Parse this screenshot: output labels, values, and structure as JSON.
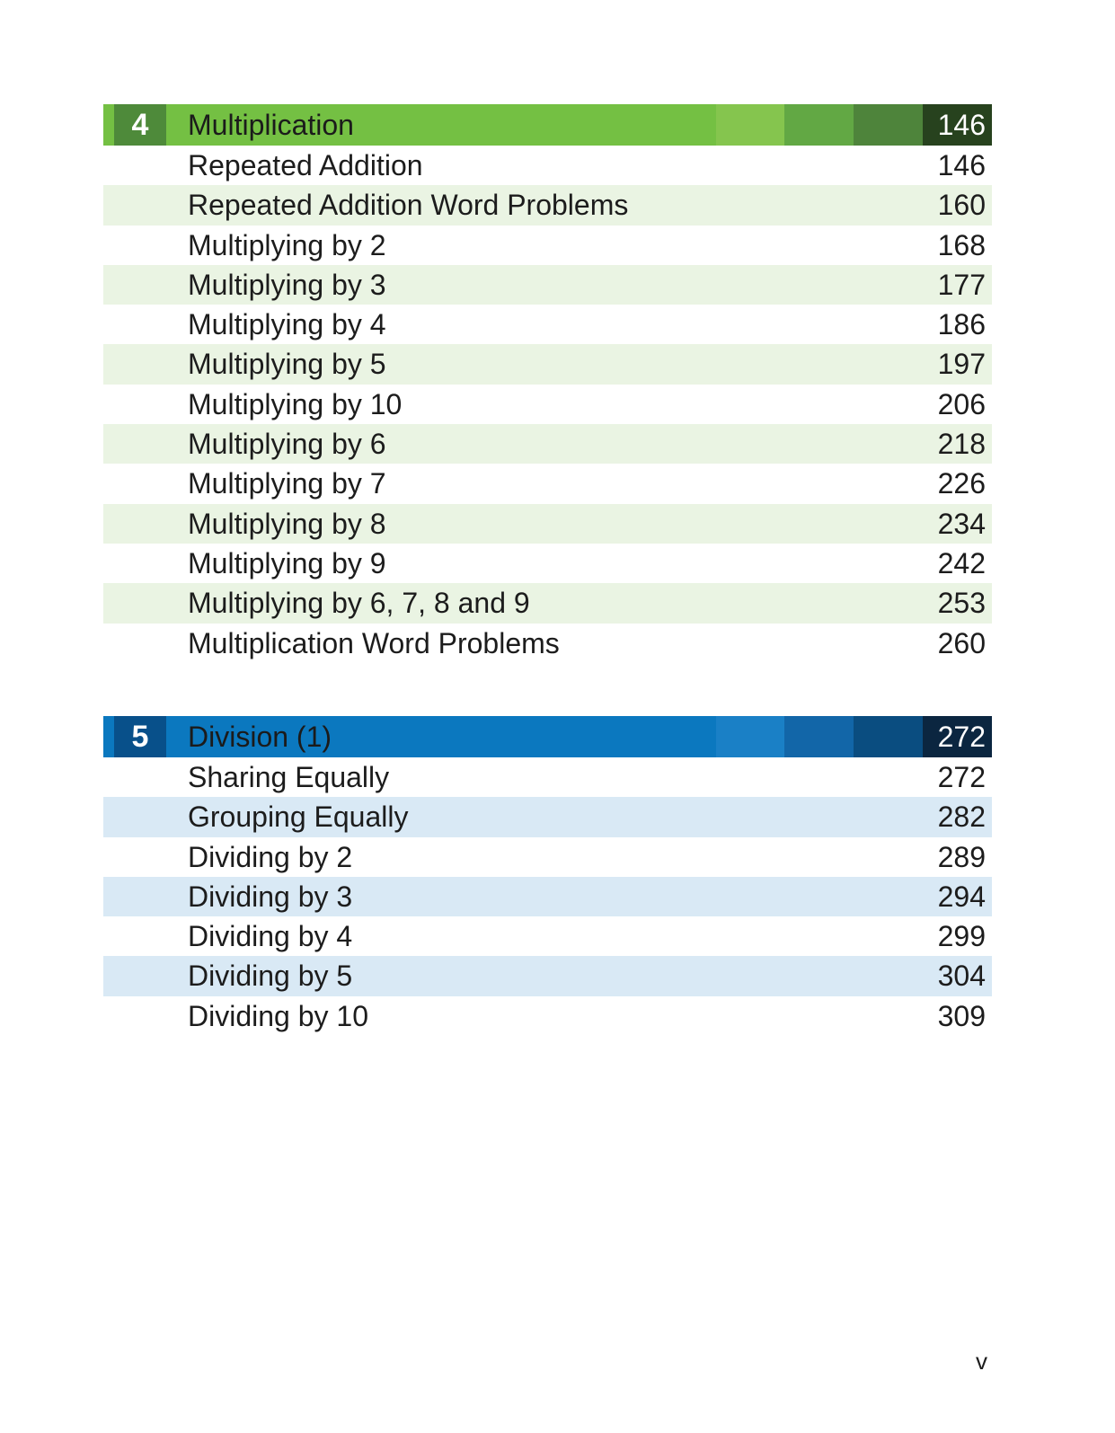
{
  "sections": [
    {
      "number": "4",
      "title": "Multiplication",
      "page": "146",
      "theme": "green",
      "colors": {
        "bar": "#74c043",
        "number_box": "#4e8a3a",
        "segments": [
          "#85c54e",
          "#62a844",
          "#4e843b",
          "#27421e"
        ],
        "row_alt": "#eaf4e3"
      },
      "topics": [
        {
          "title": "Repeated Addition",
          "page": "146"
        },
        {
          "title": "Repeated Addition Word Problems",
          "page": "160"
        },
        {
          "title": "Multiplying by 2",
          "page": "168"
        },
        {
          "title": "Multiplying by 3",
          "page": "177"
        },
        {
          "title": "Multiplying by 4",
          "page": "186"
        },
        {
          "title": "Multiplying by 5",
          "page": "197"
        },
        {
          "title": "Multiplying by 10",
          "page": "206"
        },
        {
          "title": "Multiplying by 6",
          "page": "218"
        },
        {
          "title": "Multiplying by 7",
          "page": "226"
        },
        {
          "title": "Multiplying by 8",
          "page": "234"
        },
        {
          "title": "Multiplying by 9",
          "page": "242"
        },
        {
          "title": "Multiplying by 6, 7, 8 and 9",
          "page": "253"
        },
        {
          "title": "Multiplication Word Problems",
          "page": "260"
        }
      ]
    },
    {
      "number": "5",
      "title": "Division (1)",
      "page": "272",
      "theme": "blue",
      "colors": {
        "bar": "#0b78bf",
        "number_box": "#08508a",
        "segments": [
          "#1a80c6",
          "#1266a8",
          "#0a4d80",
          "#0b2640"
        ],
        "row_alt": "#d9e9f5"
      },
      "topics": [
        {
          "title": "Sharing Equally",
          "page": "272"
        },
        {
          "title": "Grouping Equally",
          "page": "282"
        },
        {
          "title": "Dividing by 2",
          "page": "289"
        },
        {
          "title": "Dividing by 3",
          "page": "294"
        },
        {
          "title": "Dividing by 4",
          "page": "299"
        },
        {
          "title": "Dividing by 5",
          "page": "304"
        },
        {
          "title": "Dividing by 10",
          "page": "309"
        }
      ]
    }
  ],
  "footer": {
    "page_number": "v"
  }
}
